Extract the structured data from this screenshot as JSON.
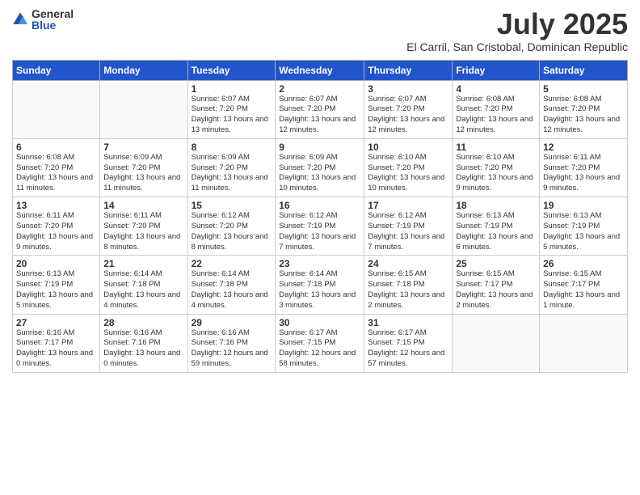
{
  "logo": {
    "general": "General",
    "blue": "Blue"
  },
  "title": "July 2025",
  "subtitle": "El Carril, San Cristobal, Dominican Republic",
  "days_header": [
    "Sunday",
    "Monday",
    "Tuesday",
    "Wednesday",
    "Thursday",
    "Friday",
    "Saturday"
  ],
  "weeks": [
    [
      {
        "num": "",
        "info": ""
      },
      {
        "num": "",
        "info": ""
      },
      {
        "num": "1",
        "info": "Sunrise: 6:07 AM\nSunset: 7:20 PM\nDaylight: 13 hours and 13 minutes."
      },
      {
        "num": "2",
        "info": "Sunrise: 6:07 AM\nSunset: 7:20 PM\nDaylight: 13 hours and 12 minutes."
      },
      {
        "num": "3",
        "info": "Sunrise: 6:07 AM\nSunset: 7:20 PM\nDaylight: 13 hours and 12 minutes."
      },
      {
        "num": "4",
        "info": "Sunrise: 6:08 AM\nSunset: 7:20 PM\nDaylight: 13 hours and 12 minutes."
      },
      {
        "num": "5",
        "info": "Sunrise: 6:08 AM\nSunset: 7:20 PM\nDaylight: 13 hours and 12 minutes."
      }
    ],
    [
      {
        "num": "6",
        "info": "Sunrise: 6:08 AM\nSunset: 7:20 PM\nDaylight: 13 hours and 11 minutes."
      },
      {
        "num": "7",
        "info": "Sunrise: 6:09 AM\nSunset: 7:20 PM\nDaylight: 13 hours and 11 minutes."
      },
      {
        "num": "8",
        "info": "Sunrise: 6:09 AM\nSunset: 7:20 PM\nDaylight: 13 hours and 11 minutes."
      },
      {
        "num": "9",
        "info": "Sunrise: 6:09 AM\nSunset: 7:20 PM\nDaylight: 13 hours and 10 minutes."
      },
      {
        "num": "10",
        "info": "Sunrise: 6:10 AM\nSunset: 7:20 PM\nDaylight: 13 hours and 10 minutes."
      },
      {
        "num": "11",
        "info": "Sunrise: 6:10 AM\nSunset: 7:20 PM\nDaylight: 13 hours and 9 minutes."
      },
      {
        "num": "12",
        "info": "Sunrise: 6:11 AM\nSunset: 7:20 PM\nDaylight: 13 hours and 9 minutes."
      }
    ],
    [
      {
        "num": "13",
        "info": "Sunrise: 6:11 AM\nSunset: 7:20 PM\nDaylight: 13 hours and 9 minutes."
      },
      {
        "num": "14",
        "info": "Sunrise: 6:11 AM\nSunset: 7:20 PM\nDaylight: 13 hours and 8 minutes."
      },
      {
        "num": "15",
        "info": "Sunrise: 6:12 AM\nSunset: 7:20 PM\nDaylight: 13 hours and 8 minutes."
      },
      {
        "num": "16",
        "info": "Sunrise: 6:12 AM\nSunset: 7:19 PM\nDaylight: 13 hours and 7 minutes."
      },
      {
        "num": "17",
        "info": "Sunrise: 6:12 AM\nSunset: 7:19 PM\nDaylight: 13 hours and 7 minutes."
      },
      {
        "num": "18",
        "info": "Sunrise: 6:13 AM\nSunset: 7:19 PM\nDaylight: 13 hours and 6 minutes."
      },
      {
        "num": "19",
        "info": "Sunrise: 6:13 AM\nSunset: 7:19 PM\nDaylight: 13 hours and 5 minutes."
      }
    ],
    [
      {
        "num": "20",
        "info": "Sunrise: 6:13 AM\nSunset: 7:19 PM\nDaylight: 13 hours and 5 minutes."
      },
      {
        "num": "21",
        "info": "Sunrise: 6:14 AM\nSunset: 7:18 PM\nDaylight: 13 hours and 4 minutes."
      },
      {
        "num": "22",
        "info": "Sunrise: 6:14 AM\nSunset: 7:18 PM\nDaylight: 13 hours and 4 minutes."
      },
      {
        "num": "23",
        "info": "Sunrise: 6:14 AM\nSunset: 7:18 PM\nDaylight: 13 hours and 3 minutes."
      },
      {
        "num": "24",
        "info": "Sunrise: 6:15 AM\nSunset: 7:18 PM\nDaylight: 13 hours and 2 minutes."
      },
      {
        "num": "25",
        "info": "Sunrise: 6:15 AM\nSunset: 7:17 PM\nDaylight: 13 hours and 2 minutes."
      },
      {
        "num": "26",
        "info": "Sunrise: 6:15 AM\nSunset: 7:17 PM\nDaylight: 13 hours and 1 minute."
      }
    ],
    [
      {
        "num": "27",
        "info": "Sunrise: 6:16 AM\nSunset: 7:17 PM\nDaylight: 13 hours and 0 minutes."
      },
      {
        "num": "28",
        "info": "Sunrise: 6:16 AM\nSunset: 7:16 PM\nDaylight: 13 hours and 0 minutes."
      },
      {
        "num": "29",
        "info": "Sunrise: 6:16 AM\nSunset: 7:16 PM\nDaylight: 12 hours and 59 minutes."
      },
      {
        "num": "30",
        "info": "Sunrise: 6:17 AM\nSunset: 7:15 PM\nDaylight: 12 hours and 58 minutes."
      },
      {
        "num": "31",
        "info": "Sunrise: 6:17 AM\nSunset: 7:15 PM\nDaylight: 12 hours and 57 minutes."
      },
      {
        "num": "",
        "info": ""
      },
      {
        "num": "",
        "info": ""
      }
    ]
  ]
}
